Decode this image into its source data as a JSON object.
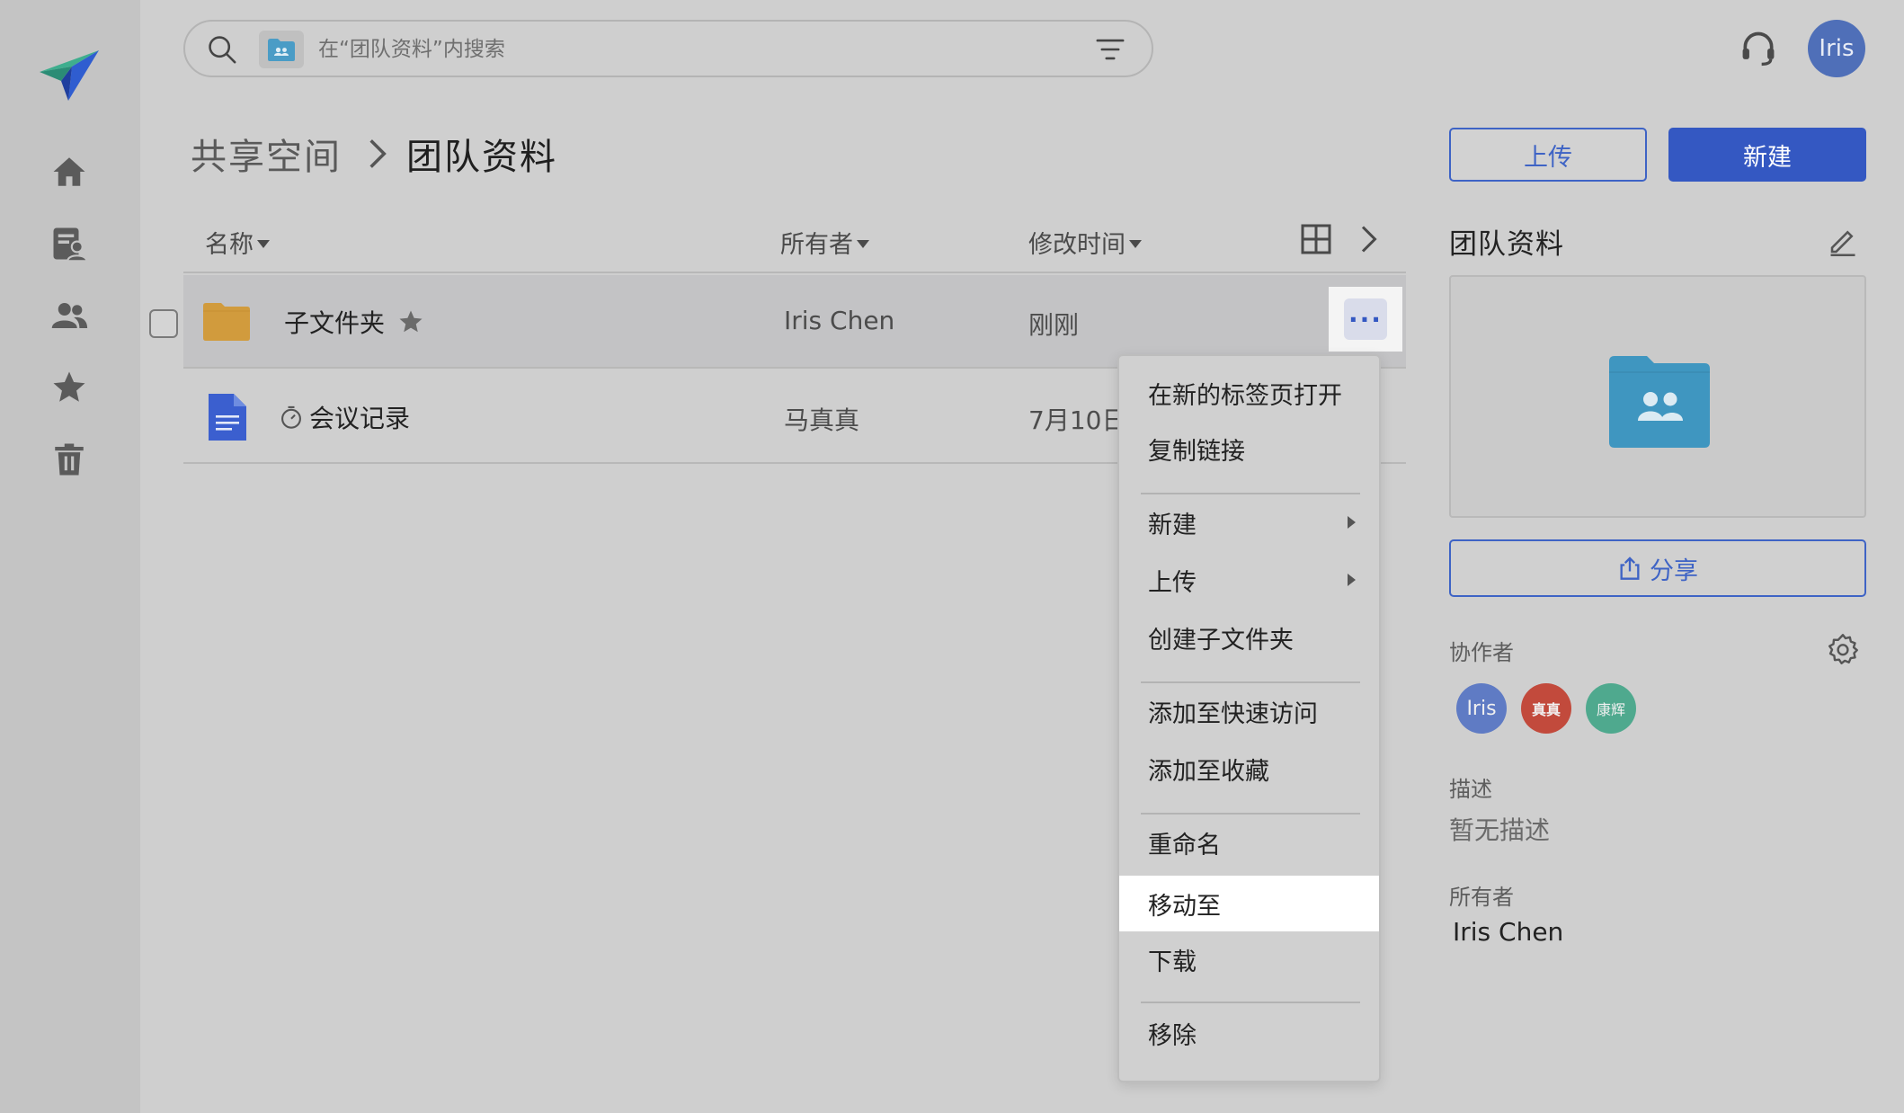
{
  "search": {
    "placeholder": "在“团队资料”内搜索"
  },
  "user": {
    "avatar_label": "Iris"
  },
  "breadcrumb": {
    "root": "共享空间",
    "current": "团队资料"
  },
  "actions": {
    "upload_label": "上传",
    "new_label": "新建"
  },
  "table": {
    "columns": {
      "name": "名称",
      "owner": "所有者",
      "modified": "修改时间"
    },
    "rows": [
      {
        "name": "子文件夹",
        "owner": "Iris Chen",
        "modified": "刚刚",
        "type": "folder",
        "starred": true
      },
      {
        "name": "会议记录",
        "owner": "马真真",
        "modified": "7月10日",
        "type": "document",
        "starred": false
      }
    ]
  },
  "context_menu": {
    "items": [
      {
        "label": "在新的标签页打开"
      },
      {
        "label": "复制链接"
      },
      {
        "label": "新建"
      },
      {
        "label": "上传"
      },
      {
        "label": "创建子文件夹"
      },
      {
        "label": "添加至快速访问"
      },
      {
        "label": "添加至收藏"
      },
      {
        "label": "重命名"
      },
      {
        "label": "移动至"
      },
      {
        "label": "下载"
      },
      {
        "label": "移除"
      }
    ],
    "highlighted": "移动至"
  },
  "details": {
    "title": "团队资料",
    "share_label": "分享",
    "collaborators_label": "协作者",
    "collaborators": [
      {
        "label": "Iris",
        "color": "#5f7bc4"
      },
      {
        "label": "真真",
        "color": "#c24a3c"
      },
      {
        "label": "康辉",
        "color": "#4fa98e"
      }
    ],
    "description_label": "描述",
    "description_value": "暂无描述",
    "owner_label": "所有者",
    "owner_value": "Iris Chen"
  },
  "colors": {
    "accent": "#3458c2",
    "folder": "#d19b3d",
    "doc": "#3b5fcf",
    "shared_folder": "#3f96c0"
  }
}
